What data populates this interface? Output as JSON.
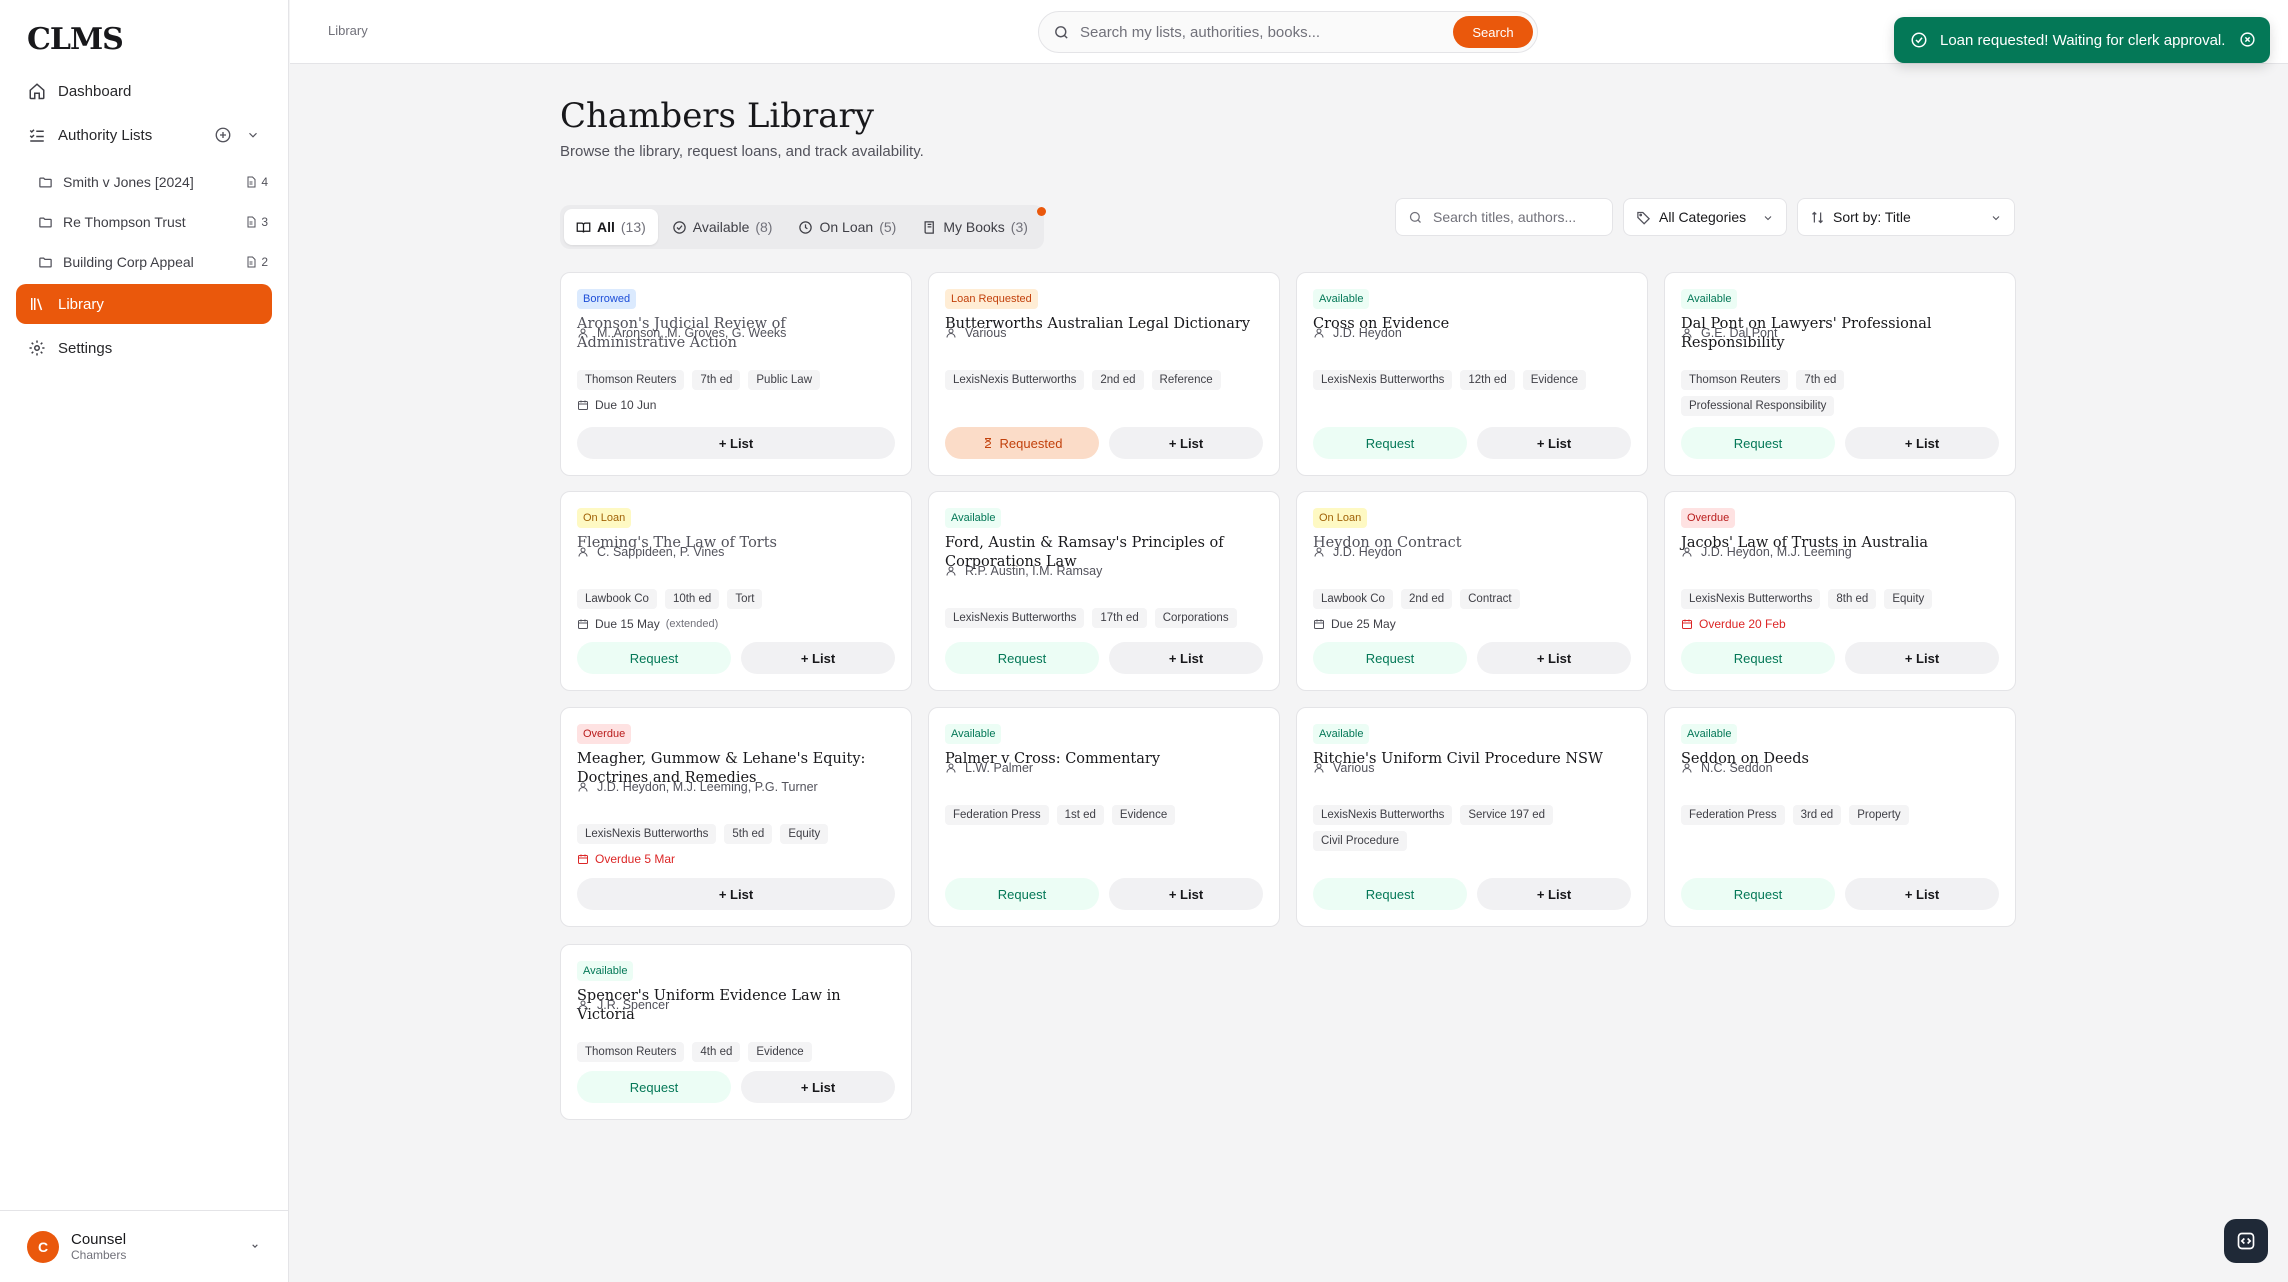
{
  "app": {
    "logo": "CLMS"
  },
  "sidebar": {
    "dashboard": "Dashboard",
    "authority_lists": "Authority Lists",
    "lists": [
      {
        "label": "Smith v Jones [2024]",
        "count": "4"
      },
      {
        "label": "Re Thompson Trust",
        "count": "3"
      },
      {
        "label": "Building Corp Appeal",
        "count": "2"
      }
    ],
    "library": "Library",
    "settings": "Settings",
    "user": {
      "initial": "C",
      "name": "Counsel",
      "role": "Chambers"
    }
  },
  "topbar": {
    "breadcrumb": "Library",
    "search_placeholder": "Search my lists, authorities, books...",
    "search_button": "Search"
  },
  "toast": {
    "message": "Loan requested! Waiting for clerk approval."
  },
  "header": {
    "title": "Chambers Library",
    "subtitle": "Browse the library, request loans, and track availability."
  },
  "tabs": [
    {
      "label": "All",
      "count": "(13)"
    },
    {
      "label": "Available",
      "count": "(8)"
    },
    {
      "label": "On Loan",
      "count": "(5)"
    },
    {
      "label": "My Books",
      "count": "(3)"
    }
  ],
  "filters": {
    "search_placeholder": "Search titles, authors...",
    "category": "All Categories",
    "sort": "Sort by: Title"
  },
  "buttons": {
    "request": "Request",
    "requested": "Requested",
    "add_list": "+ List"
  },
  "books": [
    {
      "status": "Borrowed",
      "title": "Aronson's Judicial Review of Administrative Action",
      "authors": "M. Aronson, M. Groves, G. Weeks",
      "tags": [
        "Thomson Reuters",
        "7th ed",
        "Public Law"
      ],
      "due": "Due 10 Jun"
    },
    {
      "status": "Loan Requested",
      "title": "Butterworths Australian Legal Dictionary",
      "authors": "Various",
      "tags": [
        "LexisNexis Butterworths",
        "2nd ed",
        "Reference"
      ]
    },
    {
      "status": "Available",
      "title": "Cross on Evidence",
      "authors": "J.D. Heydon",
      "tags": [
        "LexisNexis Butterworths",
        "12th ed",
        "Evidence"
      ]
    },
    {
      "status": "Available",
      "title": "Dal Pont on Lawyers' Professional Responsibility",
      "authors": "G.E. Dal Pont",
      "tags": [
        "Thomson Reuters",
        "7th ed",
        "Professional Responsibility"
      ]
    },
    {
      "status": "On Loan",
      "title": "Fleming's The Law of Torts",
      "authors": "C. Sappideen, P. Vines",
      "tags": [
        "Lawbook Co",
        "10th ed",
        "Tort"
      ],
      "due": "Due 15 May",
      "due_note": "(extended)"
    },
    {
      "status": "Available",
      "title": "Ford, Austin & Ramsay's Principles of Corporations Law",
      "authors": "R.P. Austin, I.M. Ramsay",
      "tags": [
        "LexisNexis Butterworths",
        "17th ed",
        "Corporations"
      ]
    },
    {
      "status": "On Loan",
      "title": "Heydon on Contract",
      "authors": "J.D. Heydon",
      "tags": [
        "Lawbook Co",
        "2nd ed",
        "Contract"
      ],
      "due": "Due 25 May"
    },
    {
      "status": "Overdue",
      "title": "Jacobs' Law of Trusts in Australia",
      "authors": "J.D. Heydon, M.J. Leeming",
      "tags": [
        "LexisNexis Butterworths",
        "8th ed",
        "Equity"
      ],
      "due": "Overdue 20 Feb"
    },
    {
      "status": "Overdue",
      "title": "Meagher, Gummow & Lehane's Equity: Doctrines and Remedies",
      "authors": "J.D. Heydon, M.J. Leeming, P.G. Turner",
      "tags": [
        "LexisNexis Butterworths",
        "5th ed",
        "Equity"
      ],
      "due": "Overdue 5 Mar"
    },
    {
      "status": "Available",
      "title": "Palmer v Cross: Commentary",
      "authors": "L.W. Palmer",
      "tags": [
        "Federation Press",
        "1st ed",
        "Evidence"
      ]
    },
    {
      "status": "Available",
      "title": "Ritchie's Uniform Civil Procedure NSW",
      "authors": "Various",
      "tags": [
        "LexisNexis Butterworths",
        "Service 197 ed",
        "Civil Procedure"
      ]
    },
    {
      "status": "Available",
      "title": "Seddon on Deeds",
      "authors": "N.C. Seddon",
      "tags": [
        "Federation Press",
        "3rd ed",
        "Property"
      ]
    },
    {
      "status": "Available",
      "title": "Spencer's Uniform Evidence Law in Victoria",
      "authors": "J.R. Spencer",
      "tags": [
        "Thomson Reuters",
        "4th ed",
        "Evidence"
      ]
    }
  ],
  "colors": {
    "accent": "#ea580c",
    "toast": "#047857",
    "available": "#047857",
    "overdue": "#b91c1c"
  }
}
